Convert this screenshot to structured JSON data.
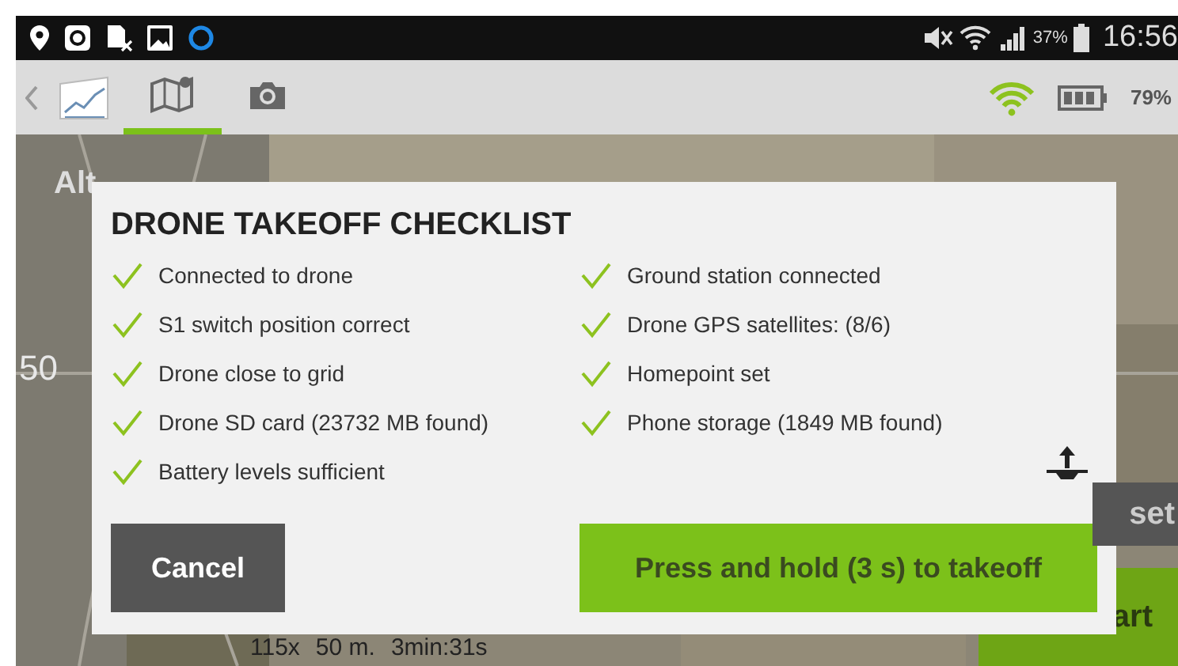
{
  "status_bar": {
    "battery": "37%",
    "time": "16:56"
  },
  "toolbar": {
    "tabs": [
      {
        "kind": "map",
        "selected": true
      },
      {
        "kind": "camera",
        "selected": false
      }
    ],
    "drone_battery": "79%"
  },
  "map": {
    "labels": [
      "Alt",
      "50"
    ],
    "info": [
      "115x",
      "50 m.",
      "3min:31s"
    ],
    "buttons": [
      {
        "label": "set",
        "kind": "dark"
      },
      {
        "label": "art",
        "kind": "green"
      }
    ]
  },
  "dialog": {
    "title": "DRONE TAKEOFF CHECKLIST",
    "columns": [
      [
        {
          "label": "Connected to drone",
          "checked": true
        },
        {
          "label": "S1 switch position correct",
          "checked": true
        },
        {
          "label": "Drone close to grid",
          "checked": true
        },
        {
          "label": "Drone SD card (23732 MB found)",
          "checked": true
        },
        {
          "label": "Battery levels sufficient",
          "checked": true
        }
      ],
      [
        {
          "label": "Ground station connected",
          "checked": true
        },
        {
          "label": "Drone GPS satellites: (8/6)",
          "checked": true
        },
        {
          "label": "Homepoint set",
          "checked": true
        },
        {
          "label": "Phone storage (1849 MB found)",
          "checked": true
        }
      ]
    ],
    "cancel": "Cancel",
    "takeoff": "Press and hold (3 s) to takeoff"
  }
}
